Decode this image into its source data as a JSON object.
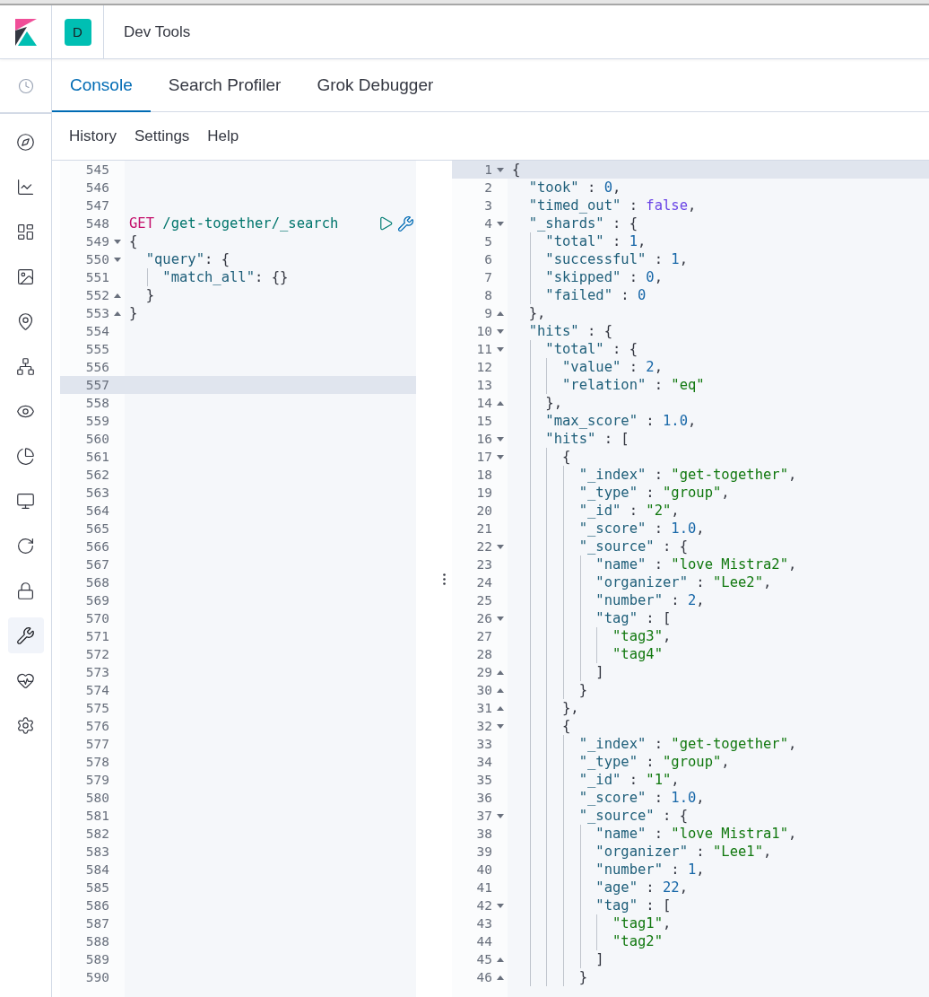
{
  "header": {
    "space_avatar": "D",
    "title": "Dev Tools"
  },
  "nav_items": [
    {
      "selected": false
    },
    {
      "selected": false
    },
    {
      "selected": false
    },
    {
      "selected": false
    },
    {
      "selected": false
    },
    {
      "selected": false
    },
    {
      "selected": false
    },
    {
      "selected": false
    },
    {
      "selected": false
    },
    {
      "selected": false
    },
    {
      "selected": false
    },
    {
      "selected": true
    },
    {
      "selected": false
    },
    {
      "selected": false
    }
  ],
  "tabs": [
    {
      "label": "Console",
      "selected": true
    },
    {
      "label": "Search Profiler",
      "selected": false
    },
    {
      "label": "Grok Debugger",
      "selected": false
    }
  ],
  "menu": [
    "History",
    "Settings",
    "Help"
  ],
  "request_editor": {
    "lines": [
      {
        "number": "545",
        "active": false
      },
      {
        "number": "546",
        "active": false
      },
      {
        "number": "547",
        "active": false
      },
      {
        "number": "548",
        "active": false,
        "tokens": [
          {
            "kind": "method",
            "text": "GET"
          },
          {
            "kind": "path",
            "text": " /get-together/_search"
          }
        ]
      },
      {
        "number": "549",
        "active": false,
        "fold_end": false,
        "tokens": [
          {
            "kind": "punct",
            "text": "{"
          }
        ]
      },
      {
        "number": "550",
        "active": false,
        "fold_end": false,
        "tokens": [
          {
            "kind": "key",
            "text": "  \"query\""
          },
          {
            "kind": "punct",
            "text": ": {"
          }
        ]
      },
      {
        "number": "551",
        "active": false,
        "tokens": [
          {
            "kind": "key",
            "text": "    \"match_all\""
          },
          {
            "kind": "punct",
            "text": ": {}"
          }
        ]
      },
      {
        "number": "552",
        "active": false,
        "fold_end": true,
        "tokens": [
          {
            "kind": "punct",
            "text": "  }"
          }
        ]
      },
      {
        "number": "553",
        "active": false,
        "fold_end": true,
        "tokens": [
          {
            "kind": "punct",
            "text": "}"
          }
        ]
      },
      {
        "number": "554",
        "active": false
      },
      {
        "number": "555",
        "active": false
      },
      {
        "number": "556",
        "active": false
      },
      {
        "number": "557",
        "active": true
      },
      {
        "number": "558",
        "active": false
      },
      {
        "number": "559",
        "active": false
      },
      {
        "number": "560",
        "active": false
      },
      {
        "number": "561",
        "active": false
      },
      {
        "number": "562",
        "active": false
      },
      {
        "number": "563",
        "active": false
      },
      {
        "number": "564",
        "active": false
      },
      {
        "number": "565",
        "active": false
      },
      {
        "number": "566",
        "active": false
      },
      {
        "number": "567",
        "active": false
      },
      {
        "number": "568",
        "active": false
      },
      {
        "number": "569",
        "active": false
      },
      {
        "number": "570",
        "active": false
      },
      {
        "number": "571",
        "active": false
      },
      {
        "number": "572",
        "active": false
      },
      {
        "number": "573",
        "active": false
      },
      {
        "number": "574",
        "active": false
      },
      {
        "number": "575",
        "active": false
      },
      {
        "number": "576",
        "active": false
      },
      {
        "number": "577",
        "active": false
      },
      {
        "number": "578",
        "active": false
      },
      {
        "number": "579",
        "active": false
      },
      {
        "number": "580",
        "active": false
      },
      {
        "number": "581",
        "active": false
      },
      {
        "number": "582",
        "active": false
      },
      {
        "number": "583",
        "active": false
      },
      {
        "number": "584",
        "active": false
      },
      {
        "number": "585",
        "active": false
      },
      {
        "number": "586",
        "active": false
      },
      {
        "number": "587",
        "active": false
      },
      {
        "number": "588",
        "active": false
      },
      {
        "number": "589",
        "active": false
      },
      {
        "number": "590",
        "active": false
      }
    ]
  },
  "response_viewer": {
    "lines": [
      {
        "number": "1",
        "active": true,
        "fold_end": false,
        "tokens": [
          {
            "kind": "punct",
            "text": "{"
          }
        ]
      },
      {
        "number": "2",
        "active": false,
        "tokens": [
          {
            "kind": "key",
            "text": "  \"took\""
          },
          {
            "kind": "punct",
            "text": " : "
          },
          {
            "kind": "number",
            "text": "0"
          },
          {
            "kind": "punct",
            "text": ","
          }
        ]
      },
      {
        "number": "3",
        "active": false,
        "tokens": [
          {
            "kind": "key",
            "text": "  \"timed_out\""
          },
          {
            "kind": "punct",
            "text": " : "
          },
          {
            "kind": "boolean",
            "text": "false"
          },
          {
            "kind": "punct",
            "text": ","
          }
        ]
      },
      {
        "number": "4",
        "active": false,
        "fold_end": false,
        "tokens": [
          {
            "kind": "key",
            "text": "  \"_shards\""
          },
          {
            "kind": "punct",
            "text": " : {"
          }
        ]
      },
      {
        "number": "5",
        "active": false,
        "tokens": [
          {
            "kind": "key",
            "text": "    \"total\""
          },
          {
            "kind": "punct",
            "text": " : "
          },
          {
            "kind": "number",
            "text": "1"
          },
          {
            "kind": "punct",
            "text": ","
          }
        ]
      },
      {
        "number": "6",
        "active": false,
        "tokens": [
          {
            "kind": "key",
            "text": "    \"successful\""
          },
          {
            "kind": "punct",
            "text": " : "
          },
          {
            "kind": "number",
            "text": "1"
          },
          {
            "kind": "punct",
            "text": ","
          }
        ]
      },
      {
        "number": "7",
        "active": false,
        "tokens": [
          {
            "kind": "key",
            "text": "    \"skipped\""
          },
          {
            "kind": "punct",
            "text": " : "
          },
          {
            "kind": "number",
            "text": "0"
          },
          {
            "kind": "punct",
            "text": ","
          }
        ]
      },
      {
        "number": "8",
        "active": false,
        "tokens": [
          {
            "kind": "key",
            "text": "    \"failed\""
          },
          {
            "kind": "punct",
            "text": " : "
          },
          {
            "kind": "number",
            "text": "0"
          }
        ]
      },
      {
        "number": "9",
        "active": false,
        "fold_end": true,
        "tokens": [
          {
            "kind": "punct",
            "text": "  },"
          }
        ]
      },
      {
        "number": "10",
        "active": false,
        "fold_end": false,
        "tokens": [
          {
            "kind": "key",
            "text": "  \"hits\""
          },
          {
            "kind": "punct",
            "text": " : {"
          }
        ]
      },
      {
        "number": "11",
        "active": false,
        "fold_end": false,
        "tokens": [
          {
            "kind": "key",
            "text": "    \"total\""
          },
          {
            "kind": "punct",
            "text": " : {"
          }
        ]
      },
      {
        "number": "12",
        "active": false,
        "tokens": [
          {
            "kind": "key",
            "text": "      \"value\""
          },
          {
            "kind": "punct",
            "text": " : "
          },
          {
            "kind": "number",
            "text": "2"
          },
          {
            "kind": "punct",
            "text": ","
          }
        ]
      },
      {
        "number": "13",
        "active": false,
        "tokens": [
          {
            "kind": "key",
            "text": "      \"relation\""
          },
          {
            "kind": "punct",
            "text": " : "
          },
          {
            "kind": "string",
            "text": "\"eq\""
          }
        ]
      },
      {
        "number": "14",
        "active": false,
        "fold_end": true,
        "tokens": [
          {
            "kind": "punct",
            "text": "    },"
          }
        ]
      },
      {
        "number": "15",
        "active": false,
        "tokens": [
          {
            "kind": "key",
            "text": "    \"max_score\""
          },
          {
            "kind": "punct",
            "text": " : "
          },
          {
            "kind": "number",
            "text": "1.0"
          },
          {
            "kind": "punct",
            "text": ","
          }
        ]
      },
      {
        "number": "16",
        "active": false,
        "fold_end": false,
        "tokens": [
          {
            "kind": "key",
            "text": "    \"hits\""
          },
          {
            "kind": "punct",
            "text": " : ["
          }
        ]
      },
      {
        "number": "17",
        "active": false,
        "fold_end": false,
        "tokens": [
          {
            "kind": "punct",
            "text": "      {"
          }
        ]
      },
      {
        "number": "18",
        "active": false,
        "tokens": [
          {
            "kind": "key",
            "text": "        \"_index\""
          },
          {
            "kind": "punct",
            "text": " : "
          },
          {
            "kind": "string",
            "text": "\"get-together\""
          },
          {
            "kind": "punct",
            "text": ","
          }
        ]
      },
      {
        "number": "19",
        "active": false,
        "tokens": [
          {
            "kind": "key",
            "text": "        \"_type\""
          },
          {
            "kind": "punct",
            "text": " : "
          },
          {
            "kind": "string",
            "text": "\"group\""
          },
          {
            "kind": "punct",
            "text": ","
          }
        ]
      },
      {
        "number": "20",
        "active": false,
        "tokens": [
          {
            "kind": "key",
            "text": "        \"_id\""
          },
          {
            "kind": "punct",
            "text": " : "
          },
          {
            "kind": "string",
            "text": "\"2\""
          },
          {
            "kind": "punct",
            "text": ","
          }
        ]
      },
      {
        "number": "21",
        "active": false,
        "tokens": [
          {
            "kind": "key",
            "text": "        \"_score\""
          },
          {
            "kind": "punct",
            "text": " : "
          },
          {
            "kind": "number",
            "text": "1.0"
          },
          {
            "kind": "punct",
            "text": ","
          }
        ]
      },
      {
        "number": "22",
        "active": false,
        "fold_end": false,
        "tokens": [
          {
            "kind": "key",
            "text": "        \"_source\""
          },
          {
            "kind": "punct",
            "text": " : {"
          }
        ]
      },
      {
        "number": "23",
        "active": false,
        "tokens": [
          {
            "kind": "key",
            "text": "          \"name\""
          },
          {
            "kind": "punct",
            "text": " : "
          },
          {
            "kind": "string",
            "text": "\"love Mistra2\""
          },
          {
            "kind": "punct",
            "text": ","
          }
        ]
      },
      {
        "number": "24",
        "active": false,
        "tokens": [
          {
            "kind": "key",
            "text": "          \"organizer\""
          },
          {
            "kind": "punct",
            "text": " : "
          },
          {
            "kind": "string",
            "text": "\"Lee2\""
          },
          {
            "kind": "punct",
            "text": ","
          }
        ]
      },
      {
        "number": "25",
        "active": false,
        "tokens": [
          {
            "kind": "key",
            "text": "          \"number\""
          },
          {
            "kind": "punct",
            "text": " : "
          },
          {
            "kind": "number",
            "text": "2"
          },
          {
            "kind": "punct",
            "text": ","
          }
        ]
      },
      {
        "number": "26",
        "active": false,
        "fold_end": false,
        "tokens": [
          {
            "kind": "key",
            "text": "          \"tag\""
          },
          {
            "kind": "punct",
            "text": " : ["
          }
        ]
      },
      {
        "number": "27",
        "active": false,
        "tokens": [
          {
            "kind": "string",
            "text": "            \"tag3\""
          },
          {
            "kind": "punct",
            "text": ","
          }
        ]
      },
      {
        "number": "28",
        "active": false,
        "tokens": [
          {
            "kind": "string",
            "text": "            \"tag4\""
          }
        ]
      },
      {
        "number": "29",
        "active": false,
        "fold_end": true,
        "tokens": [
          {
            "kind": "punct",
            "text": "          ]"
          }
        ]
      },
      {
        "number": "30",
        "active": false,
        "fold_end": true,
        "tokens": [
          {
            "kind": "punct",
            "text": "        }"
          }
        ]
      },
      {
        "number": "31",
        "active": false,
        "fold_end": true,
        "tokens": [
          {
            "kind": "punct",
            "text": "      },"
          }
        ]
      },
      {
        "number": "32",
        "active": false,
        "fold_end": false,
        "tokens": [
          {
            "kind": "punct",
            "text": "      {"
          }
        ]
      },
      {
        "number": "33",
        "active": false,
        "tokens": [
          {
            "kind": "key",
            "text": "        \"_index\""
          },
          {
            "kind": "punct",
            "text": " : "
          },
          {
            "kind": "string",
            "text": "\"get-together\""
          },
          {
            "kind": "punct",
            "text": ","
          }
        ]
      },
      {
        "number": "34",
        "active": false,
        "tokens": [
          {
            "kind": "key",
            "text": "        \"_type\""
          },
          {
            "kind": "punct",
            "text": " : "
          },
          {
            "kind": "string",
            "text": "\"group\""
          },
          {
            "kind": "punct",
            "text": ","
          }
        ]
      },
      {
        "number": "35",
        "active": false,
        "tokens": [
          {
            "kind": "key",
            "text": "        \"_id\""
          },
          {
            "kind": "punct",
            "text": " : "
          },
          {
            "kind": "string",
            "text": "\"1\""
          },
          {
            "kind": "punct",
            "text": ","
          }
        ]
      },
      {
        "number": "36",
        "active": false,
        "tokens": [
          {
            "kind": "key",
            "text": "        \"_score\""
          },
          {
            "kind": "punct",
            "text": " : "
          },
          {
            "kind": "number",
            "text": "1.0"
          },
          {
            "kind": "punct",
            "text": ","
          }
        ]
      },
      {
        "number": "37",
        "active": false,
        "fold_end": false,
        "tokens": [
          {
            "kind": "key",
            "text": "        \"_source\""
          },
          {
            "kind": "punct",
            "text": " : {"
          }
        ]
      },
      {
        "number": "38",
        "active": false,
        "tokens": [
          {
            "kind": "key",
            "text": "          \"name\""
          },
          {
            "kind": "punct",
            "text": " : "
          },
          {
            "kind": "string",
            "text": "\"love Mistra1\""
          },
          {
            "kind": "punct",
            "text": ","
          }
        ]
      },
      {
        "number": "39",
        "active": false,
        "tokens": [
          {
            "kind": "key",
            "text": "          \"organizer\""
          },
          {
            "kind": "punct",
            "text": " : "
          },
          {
            "kind": "string",
            "text": "\"Lee1\""
          },
          {
            "kind": "punct",
            "text": ","
          }
        ]
      },
      {
        "number": "40",
        "active": false,
        "tokens": [
          {
            "kind": "key",
            "text": "          \"number\""
          },
          {
            "kind": "punct",
            "text": " : "
          },
          {
            "kind": "number",
            "text": "1"
          },
          {
            "kind": "punct",
            "text": ","
          }
        ]
      },
      {
        "number": "41",
        "active": false,
        "tokens": [
          {
            "kind": "key",
            "text": "          \"age\""
          },
          {
            "kind": "punct",
            "text": " : "
          },
          {
            "kind": "number",
            "text": "22"
          },
          {
            "kind": "punct",
            "text": ","
          }
        ]
      },
      {
        "number": "42",
        "active": false,
        "fold_end": false,
        "tokens": [
          {
            "kind": "key",
            "text": "          \"tag\""
          },
          {
            "kind": "punct",
            "text": " : ["
          }
        ]
      },
      {
        "number": "43",
        "active": false,
        "tokens": [
          {
            "kind": "string",
            "text": "            \"tag1\""
          },
          {
            "kind": "punct",
            "text": ","
          }
        ]
      },
      {
        "number": "44",
        "active": false,
        "tokens": [
          {
            "kind": "string",
            "text": "            \"tag2\""
          }
        ]
      },
      {
        "number": "45",
        "active": false,
        "fold_end": true,
        "tokens": [
          {
            "kind": "punct",
            "text": "          ]"
          }
        ]
      },
      {
        "number": "46",
        "active": false,
        "fold_end": true,
        "tokens": [
          {
            "kind": "punct",
            "text": "        }"
          }
        ]
      }
    ]
  }
}
